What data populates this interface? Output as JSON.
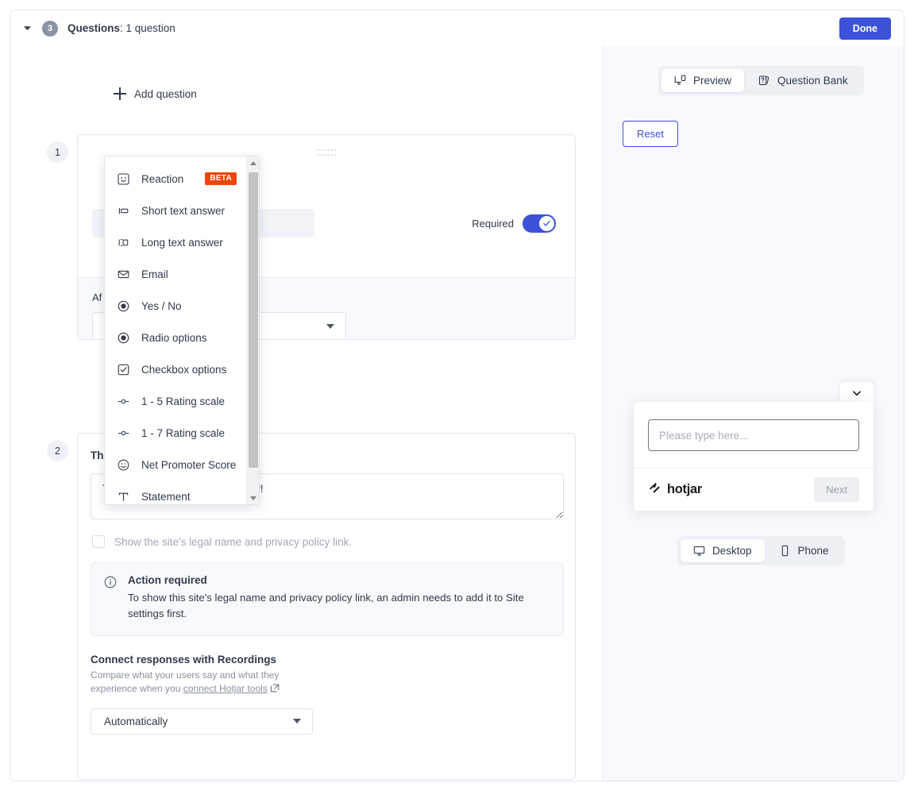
{
  "header": {
    "step_number": "3",
    "title_label": "Questions",
    "title_value": ": 1 question",
    "done_label": "Done",
    "collapse_icon": "caret-down-icon"
  },
  "left_pane": {
    "add_question_label": "Add question",
    "add_question_icon": "plus-icon",
    "question_1": {
      "badge": "1",
      "required_label": "Required",
      "required_enabled": true,
      "after_label": "Af",
      "after_value": ""
    },
    "question_2": {
      "badge": "2",
      "title": "Th",
      "thankyou_text": "Thanks for completing the survey!",
      "legal_checkbox_label": "Show the site's legal name and privacy policy link.",
      "legal_checkbox_checked": false,
      "notice": {
        "icon": "info-circle-icon",
        "title": "Action required",
        "body": "To show this site's legal name and privacy policy link, an admin needs to add it to Site settings first."
      },
      "connect": {
        "title": "Connect responses with Recordings",
        "subtitle_prefix": "Compare what your users say and what they experience when you ",
        "link_label": "connect Hotjar tools",
        "link_icon": "external-link-icon",
        "select_value": "Automatically"
      }
    }
  },
  "type_menu": {
    "items": [
      {
        "label": "Reaction",
        "icon": "reaction-smiley-icon",
        "badge": "BETA"
      },
      {
        "label": "Short text answer",
        "icon": "short-text-icon",
        "badge": ""
      },
      {
        "label": "Long text answer",
        "icon": "long-text-icon",
        "badge": ""
      },
      {
        "label": "Email",
        "icon": "envelope-icon",
        "badge": ""
      },
      {
        "label": "Yes / No",
        "icon": "radio-filled-icon",
        "badge": ""
      },
      {
        "label": "Radio options",
        "icon": "radio-filled-icon",
        "badge": ""
      },
      {
        "label": "Checkbox options",
        "icon": "checkbox-checked-icon",
        "badge": ""
      },
      {
        "label": "1 - 5 Rating scale",
        "icon": "rating-scale-icon",
        "badge": ""
      },
      {
        "label": "1 - 7 Rating scale",
        "icon": "rating-scale-icon",
        "badge": ""
      },
      {
        "label": "Net Promoter Score",
        "icon": "smiley-outline-icon",
        "badge": ""
      },
      {
        "label": "Statement",
        "icon": "text-t-icon",
        "badge": ""
      }
    ]
  },
  "right_pane": {
    "tabs": [
      {
        "label": "Preview",
        "icon": "monitor-preview-icon",
        "active": true
      },
      {
        "label": "Question Bank",
        "icon": "cards-question-icon",
        "active": false
      }
    ],
    "reset_label": "Reset",
    "widget": {
      "collapse_icon": "chevron-down-icon",
      "input_placeholder": "Please type here...",
      "input_value": "",
      "brand_label": "hotjar",
      "brand_icon": "hotjar-mark-icon",
      "next_label": "Next"
    },
    "device_tabs": [
      {
        "label": "Desktop",
        "icon": "monitor-icon",
        "active": true
      },
      {
        "label": "Phone",
        "icon": "phone-icon",
        "active": false
      }
    ]
  },
  "colors": {
    "accent": "#3b52d9",
    "beta_badge": "#f4420c",
    "panel_bg": "#f8f9fc",
    "border": "#e4e6ef"
  }
}
